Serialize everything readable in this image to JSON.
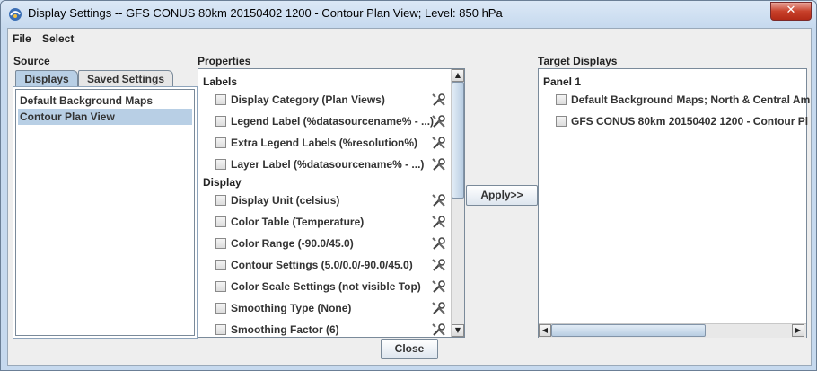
{
  "window": {
    "title": "Display Settings -- GFS CONUS 80km 20150402 1200 - Contour Plan View; Level: 850 hPa",
    "close_glyph": "✕"
  },
  "menu": {
    "file": "File",
    "select": "Select"
  },
  "source": {
    "label": "Source",
    "tabs": [
      "Displays",
      "Saved Settings"
    ],
    "items": [
      "Default Background Maps",
      "Contour Plan View"
    ],
    "selected_index": 1
  },
  "properties": {
    "label": "Properties",
    "groups": {
      "labels": {
        "title": "Labels",
        "items": [
          "Display Category (Plan Views)",
          "Legend Label (%datasourcename% - ...)",
          "Extra Legend Labels (%resolution%)",
          "Layer Label (%datasourcename% - ...)"
        ]
      },
      "display": {
        "title": "Display",
        "items": [
          "Display Unit (celsius)",
          "Color Table (Temperature)",
          "Color Range (-90.0/45.0)",
          "Contour Settings (5.0/0.0/-90.0/45.0)",
          "Color Scale Settings (not visible Top)",
          "Smoothing Type (None)",
          "Smoothing Factor (6)"
        ]
      }
    }
  },
  "apply_button": "Apply>>",
  "targets": {
    "label": "Target Displays",
    "panel": "Panel 1",
    "items": [
      "Default Background Maps; North & Central Am",
      "GFS CONUS 80km 20150402 1200 - Contour Pl"
    ]
  },
  "close_button": "Close",
  "colors": {
    "selection": "#b8cfe5",
    "title_close": "#c8412b"
  }
}
